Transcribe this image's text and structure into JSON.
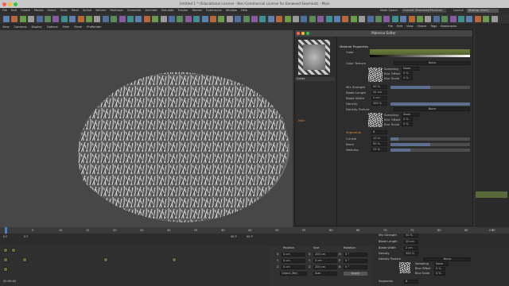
{
  "window": {
    "title": "Untitled 1 * (Educational License - Non-Commercial License for Eanwood Sawmoot) - Main"
  },
  "menubar": {
    "items": [
      "File",
      "Edit",
      "Create",
      "Modes",
      "Select",
      "Tools",
      "Mesh",
      "Spline",
      "Volume",
      "MoGraph",
      "Character",
      "Animate",
      "Simulate",
      "Tracker",
      "Render",
      "Extensions",
      "Window",
      "Help"
    ],
    "node_space_label": "Node Space:",
    "node_space_value": "Current (Standard/Physical)",
    "layout_label": "Layout:",
    "layout_value": "Startup (User)"
  },
  "viewport": {
    "menu": [
      "View",
      "Cameras",
      "Display",
      "Options",
      "Filter",
      "Panel",
      "ProRender"
    ]
  },
  "objects_menu": [
    "File",
    "Edit",
    "View",
    "Object",
    "Tags",
    "Bookmarks"
  ],
  "material_editor": {
    "title": "Material Editor",
    "preview_name": "Grass",
    "section_title": "Material Properties",
    "sidebar_item": "Main",
    "rows": {
      "color": "Color",
      "color_texture": "Color Texture",
      "color_texture_value": "Noise",
      "sampling": "Sampling",
      "sampling_value": "None",
      "blur_offset": "Blur Offset",
      "blur_offset_value": "0 %",
      "blur_scale": "Blur Scale",
      "blur_scale_value": "0 %",
      "mix_strength": "Mix Strength",
      "mix_strength_value": "50 %",
      "mix_strength_fill": 0.5,
      "blade_length": "Blade Length",
      "blade_length_value": "20 cm",
      "blade_width": "Blade Width",
      "blade_width_value": "2 cm",
      "density": "Density",
      "density_value": "300 %",
      "density_texture": "Density Texture",
      "density_texture_value": "Noise",
      "sampling2": "Sampling",
      "sampling2_value": "None",
      "blur_offset2": "Blur Offset",
      "blur_offset2_value": "0 %",
      "blur_scale2": "Blur Scale",
      "blur_scale2_value": "0 %",
      "segments": "Segments",
      "segments_value": "8",
      "crinkle": "Crinkle",
      "crinkle_value": "10 %",
      "crinkle_fill": 0.1,
      "bend": "Bend",
      "bend_value": "50 %",
      "bend_fill": 0.5,
      "wetness": "Wetness",
      "wetness_value": "25 %",
      "wetness_fill": 0.25
    }
  },
  "attributes_behind": {
    "mix_strength": "Mix Strength",
    "mix_strength_value": "50 %",
    "blade_length": "Blade Length",
    "blade_length_value": "20 cm",
    "blade_width": "Blade Width",
    "blade_width_value": "2 cm",
    "density": "Density",
    "density_value": "300 %",
    "density_texture": "Density Texture",
    "density_texture_value": "Noise",
    "sampling": "Sampling",
    "sampling_value": "None",
    "blur_offset": "Blur Offset",
    "blur_offset_value": "0 %",
    "blur_scale": "Blur Scale",
    "blur_scale_value": "0 %",
    "segments": "Segments",
    "segments_value": "8"
  },
  "timeline": {
    "ticks": [
      "0",
      "5",
      "10",
      "15",
      "20",
      "25",
      "30",
      "35",
      "40",
      "45",
      "50",
      "55",
      "60",
      "65",
      "70",
      "75",
      "80",
      "85",
      "90"
    ],
    "start": "0 F",
    "current": "0 F",
    "end": "90 F",
    "end2": "90 F",
    "frame_indicator": "0 F"
  },
  "coords": {
    "position": "Position",
    "size": "Size",
    "rotation": "Rotation",
    "x": "X",
    "y": "Y",
    "z": "Z",
    "px": "0 cm",
    "py": "0 cm",
    "pz": "0 cm",
    "sx": "200 cm",
    "sy": "0 cm",
    "sz": "200 cm",
    "h": "H",
    "p": "P",
    "b": "B",
    "rh": "0 °",
    "rp": "0 °",
    "rb": "0 °",
    "mode": "Object (Rel)",
    "size_mode": "Size",
    "apply": "Apply"
  },
  "status": {
    "time": "00:00:00"
  }
}
